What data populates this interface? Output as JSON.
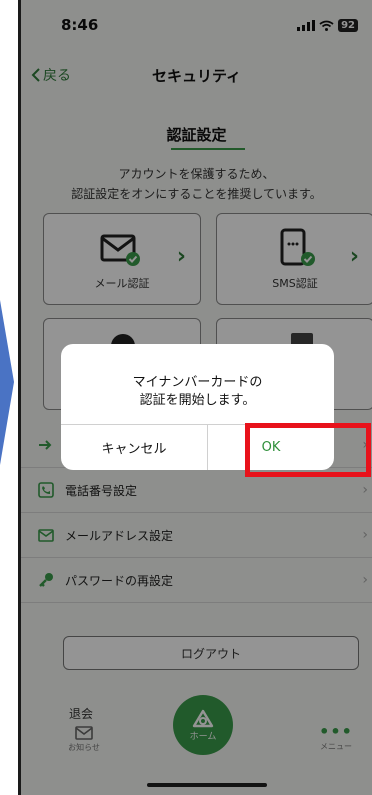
{
  "status_bar": {
    "time": "8:46",
    "battery": "92"
  },
  "nav": {
    "back_label": "戻る",
    "title": "セキュリティ"
  },
  "section": {
    "title": "認証設定",
    "description_line1": "アカウントを保護するため、",
    "description_line2": "認証設定をオンにすることを推奨しています。"
  },
  "auth_cards": [
    {
      "label": "メール認証",
      "icon": "mail-check-icon"
    },
    {
      "label": "SMS認証",
      "icon": "phone-check-icon"
    }
  ],
  "list": [
    {
      "label": "電話番号設定",
      "icon": "phone-icon"
    },
    {
      "label": "メールアドレス設定",
      "icon": "mail-icon"
    },
    {
      "label": "パスワードの再設定",
      "icon": "key-icon"
    }
  ],
  "logout_label": "ログアウト",
  "withdraw_label": "退会",
  "tabbar": {
    "notice": "お知らせ",
    "home": "ホーム",
    "menu": "メニュー"
  },
  "dialog": {
    "message_line1": "マイナンバーカードの",
    "message_line2": "認証を開始します。",
    "cancel_label": "キャンセル",
    "ok_label": "OK"
  },
  "colors": {
    "accent": "#3a9c4a",
    "highlight": "#e8121b",
    "annotation_arrow": "#4a73c4"
  }
}
